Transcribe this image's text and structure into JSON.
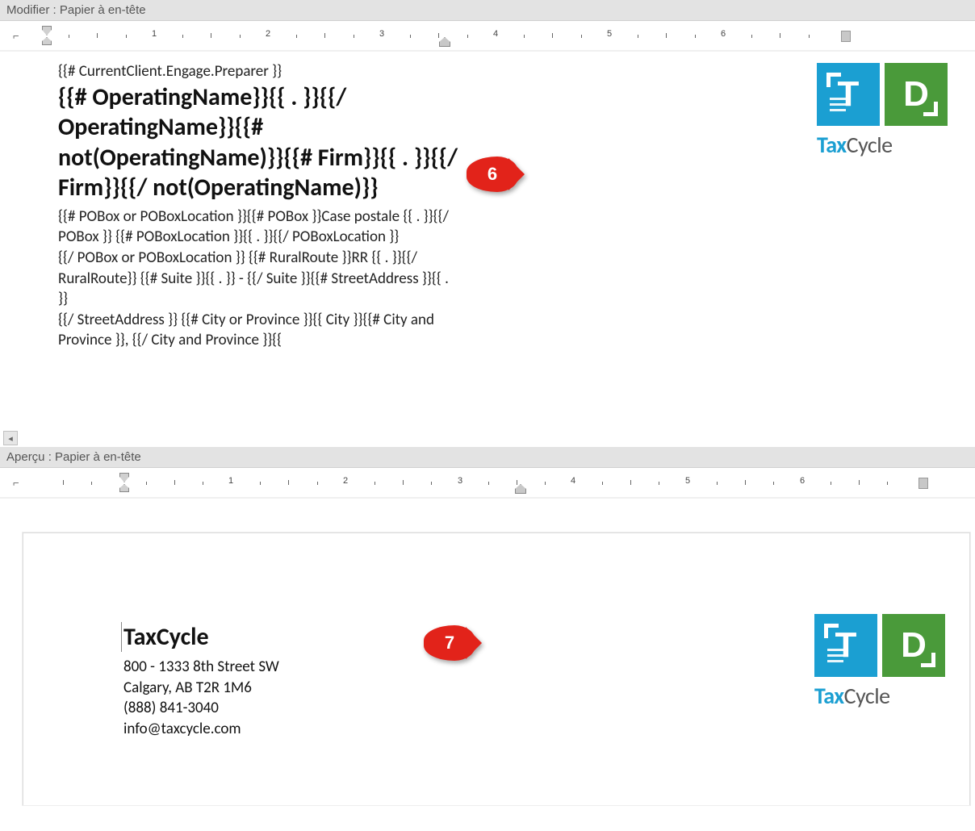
{
  "panels": {
    "editor_title": "Modifier : Papier à en-tête",
    "preview_title": "Aperçu : Papier à en-tête"
  },
  "ruler": {
    "numbers": [
      1,
      2,
      3,
      4,
      5,
      6
    ]
  },
  "callouts": {
    "six": "6",
    "seven": "7"
  },
  "logo": {
    "letter_t": "T",
    "letter_d": "D",
    "brand_tax": "Tax",
    "brand_cycle": "Cycle"
  },
  "template": {
    "line_preparer": "{{# CurrentClient.Engage.Preparer }}",
    "heading": "{{# OperatingName}}{{ . }}{{/ OperatingName}}{{# not(OperatingName)}}{{# Firm}}{{ . }}{{/ Firm}}{{/ not(OperatingName)}}",
    "body1": "{{# POBox or POBoxLocation }}{{# POBox }}Case postale {{ . }}{{/ POBox }} {{# POBoxLocation }}{{ . }}{{/ POBoxLocation }}",
    "body2": "{{/ POBox or POBoxLocation }} {{# RuralRoute }}RR {{ . }}{{/ RuralRoute}} {{# Suite }}{{ . }} - {{/ Suite }}{{# StreetAddress }}{{ . }}",
    "body3": "{{/ StreetAddress }} {{# City or Province }}{{ City }}{{# City and Province }}, {{/ City and Province }}{{"
  },
  "preview": {
    "company": "TaxCycle",
    "address_line": "800 - 1333 8th Street SW",
    "city_line": "Calgary, AB  T2R 1M6",
    "phone": "(888) 841-3040",
    "email": "info@taxcycle.com"
  }
}
